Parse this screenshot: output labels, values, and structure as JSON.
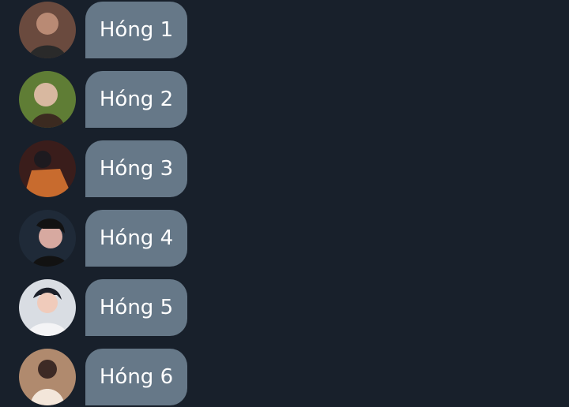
{
  "colors": {
    "background": "#18202b",
    "bubble": "#667888",
    "text": "#ffffff"
  },
  "messages": [
    {
      "text": "Hóng 1",
      "avatar_icon": "avatar-photo-icon",
      "tone": [
        "#6a4a3e",
        "#b98a74",
        "#2a2a2a"
      ]
    },
    {
      "text": "Hóng 2",
      "avatar_icon": "avatar-photo-icon",
      "tone": [
        "#5f7d35",
        "#d8b8a0",
        "#3b2a20"
      ]
    },
    {
      "text": "Hóng 3",
      "avatar_icon": "avatar-photo-icon",
      "tone": [
        "#3a1d1b",
        "#c86b2e",
        "#1d1a1f"
      ]
    },
    {
      "text": "Hóng 4",
      "avatar_icon": "avatar-photo-icon",
      "tone": [
        "#1f2a38",
        "#d7a9a0",
        "#121212"
      ]
    },
    {
      "text": "Hóng 5",
      "avatar_icon": "avatar-photo-icon",
      "tone": [
        "#d9dde3",
        "#f0cbbb",
        "#1b1f29"
      ]
    },
    {
      "text": "Hóng 6",
      "avatar_icon": "avatar-photo-icon",
      "tone": [
        "#b08a6e",
        "#f3e6da",
        "#3d2a25"
      ]
    }
  ]
}
